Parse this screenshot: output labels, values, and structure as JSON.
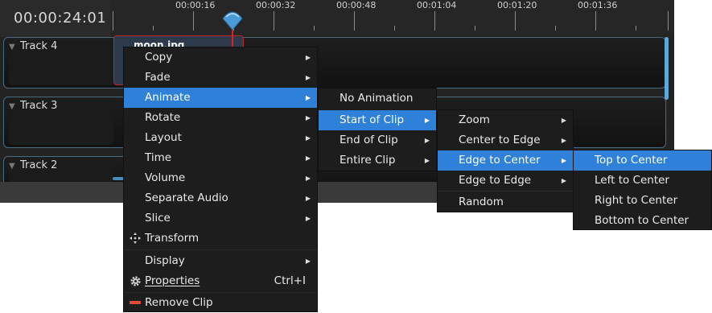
{
  "timeline": {
    "timecode": "00:00:24:01",
    "ruler_labels": [
      "00:00:16",
      "00:00:32",
      "00:00:48",
      "00:01:04",
      "00:01:20",
      "00:01:36"
    ],
    "tracks": [
      "Track 4",
      "Track 3",
      "Track 2"
    ],
    "clip_title": "moon.jpg"
  },
  "context_menu": {
    "items": {
      "copy": "Copy",
      "fade": "Fade",
      "animate": "Animate",
      "rotate": "Rotate",
      "layout": "Layout",
      "time": "Time",
      "volume": "Volume",
      "separate_audio": "Separate Audio",
      "slice": "Slice",
      "transform": "Transform",
      "display": "Display",
      "properties": "Properties",
      "properties_shortcut": "Ctrl+I",
      "remove_clip": "Remove Clip"
    }
  },
  "animate_menu": {
    "no_animation": "No Animation",
    "start_of_clip": "Start of Clip",
    "end_of_clip": "End of Clip",
    "entire_clip": "Entire Clip"
  },
  "start_menu": {
    "zoom": "Zoom",
    "center_to_edge": "Center to Edge",
    "edge_to_center": "Edge to Center",
    "edge_to_edge": "Edge to Edge",
    "random": "Random"
  },
  "edge_menu": {
    "top_to_center": "Top to Center",
    "left_to_center": "Left to Center",
    "right_to_center": "Right to Center",
    "bottom_to_center": "Bottom to Center"
  },
  "colors": {
    "highlight": "#2e80d8",
    "track_border": "#4a6a82",
    "playhead": "#e02020"
  }
}
